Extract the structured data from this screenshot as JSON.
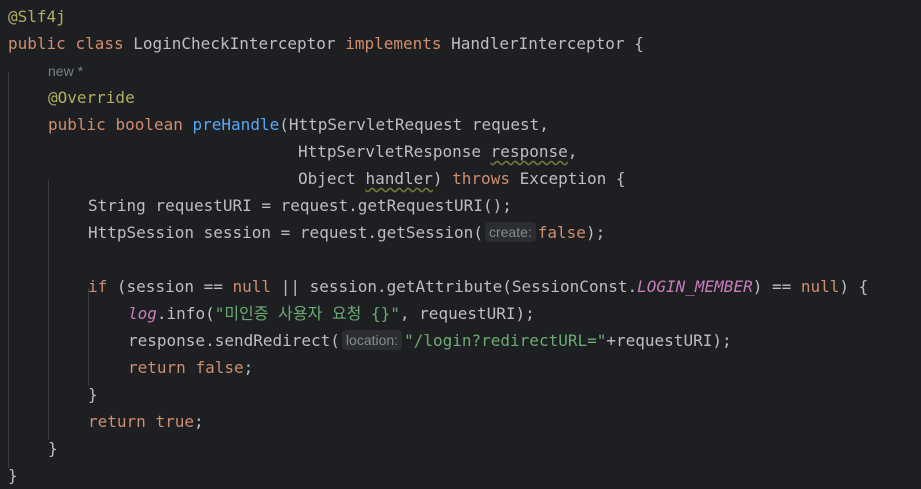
{
  "code": {
    "l1_annotation": "@Slf4j",
    "l2_public": "public",
    "l2_class": "class",
    "l2_name": "LoginCheckInterceptor",
    "l2_implements": "implements",
    "l2_iface": "HandlerInterceptor",
    "l2_brace": "{",
    "l3_lens": "new *",
    "l4_override": "@Override",
    "l5_public": "public",
    "l5_boolean": "boolean",
    "l5_method": "preHandle",
    "l5_params": "(HttpServletRequest request,",
    "l6_type": "HttpServletResponse",
    "l6_param": "response",
    "l6_comma": ",",
    "l7_type": "Object",
    "l7_param": "handler",
    "l7_paren": ")",
    "l7_throws": "throws",
    "l7_exc": "Exception {",
    "l8_text": "String requestURI = request.getRequestURI();",
    "l9_text": "HttpSession session = request.getSession(",
    "l9_hint": "create:",
    "l9_false": "false",
    "l9_end": ");",
    "l11_if": "if",
    "l11_a": "(session ==",
    "l11_null1": "null",
    "l11_b": "|| session.getAttribute(SessionConst.",
    "l11_const": "LOGIN_MEMBER",
    "l11_c": ") ==",
    "l11_null2": "null",
    "l11_d": ") {",
    "l12_log": "log",
    "l12_a": ".info(",
    "l12_str": "\"미인증 사용자 요청 {}\"",
    "l12_b": ", requestURI);",
    "l13_a": "response.sendRedirect(",
    "l13_hint": "location:",
    "l13_str": "\"/login?redirectURL=\"",
    "l13_b": "+requestURI);",
    "l14_return": "return",
    "l14_false": "false",
    "l14_end": ";",
    "l15_brace": "}",
    "l16_return": "return",
    "l16_true": "true",
    "l16_end": ";",
    "l17_brace": "}",
    "l18_brace": "}"
  }
}
